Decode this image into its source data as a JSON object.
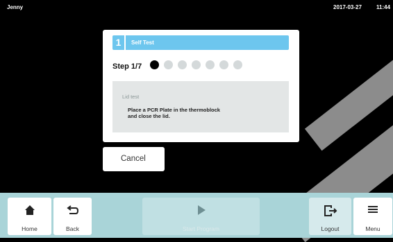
{
  "status_bar": {
    "user": "Jenny",
    "date": "2017-03-27",
    "time": "11:44"
  },
  "dialog": {
    "step_number": "1",
    "title": "Self Test",
    "step_label": "Step 1/7",
    "steps_total": 7,
    "current_step": 1,
    "instruction_title": "Lid test",
    "instruction_text": "Place a PCR Plate in the thermoblock\nand close the lid.",
    "cancel_label": "Cancel"
  },
  "toolbar": {
    "home_label": "Home",
    "back_label": "Back",
    "start_label": "Start Program",
    "logout_label": "Logout",
    "menu_label": "Menu"
  },
  "colors": {
    "accent": "#6dc6ee",
    "toolbar": "#a9d4d8",
    "active_dot": "#000000",
    "inactive_dot": "#d4d9da"
  }
}
